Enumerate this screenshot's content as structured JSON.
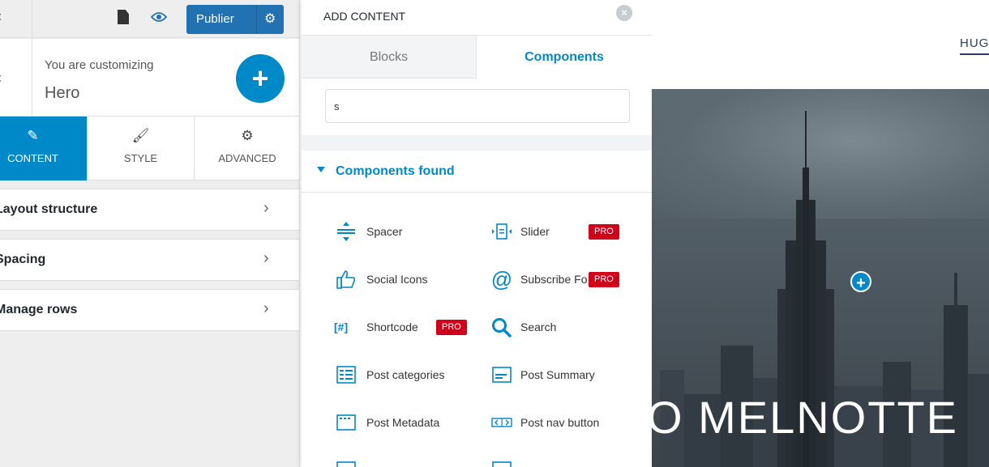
{
  "topbar": {
    "close_glyph": "‹",
    "publish_label": "Publier"
  },
  "customizing": {
    "back_glyph": "‹",
    "subtitle": "You are customizing",
    "title": "Hero"
  },
  "tabs": [
    {
      "label": "CONTENT",
      "icon": "pencil-icon",
      "glyph": "✎",
      "active": true
    },
    {
      "label": "STYLE",
      "icon": "brush-icon",
      "glyph": "🖌",
      "active": false
    },
    {
      "label": "ADVANCED",
      "icon": "gears-icon",
      "glyph": "⚙",
      "active": false
    }
  ],
  "accordion": [
    {
      "label": "Layout structure"
    },
    {
      "label": "Spacing"
    },
    {
      "label": "Manage rows"
    }
  ],
  "add_content": {
    "title": "ADD CONTENT",
    "tabs": {
      "blocks": "Blocks",
      "components": "Components"
    },
    "search_value": "s",
    "found_label": "Components found",
    "pro_label": "PRO",
    "components": [
      {
        "label": "Spacer",
        "icon": "spacer-icon",
        "pro": false
      },
      {
        "label": "Slider",
        "icon": "slider-icon",
        "pro": true
      },
      {
        "label": "Social Icons",
        "icon": "thumbs-up-icon",
        "pro": false
      },
      {
        "label": "Subscribe Fo",
        "icon": "at-sign-icon",
        "pro": true
      },
      {
        "label": "Shortcode",
        "icon": "shortcode-icon",
        "pro": true
      },
      {
        "label": "Search",
        "icon": "search-icon",
        "pro": false
      },
      {
        "label": "Post categories",
        "icon": "post-categories-icon",
        "pro": false
      },
      {
        "label": "Post Summary",
        "icon": "post-summary-icon",
        "pro": false
      },
      {
        "label": "Post Metadata",
        "icon": "post-metadata-icon",
        "pro": false
      },
      {
        "label": "Post nav button",
        "icon": "post-nav-icon",
        "pro": false
      }
    ]
  },
  "preview": {
    "nav_link": "HUG",
    "hero_title": "O MELNOTTE"
  },
  "colors": {
    "accent": "#0089c8",
    "publish": "#2271b1",
    "pro": "#d0021b"
  }
}
